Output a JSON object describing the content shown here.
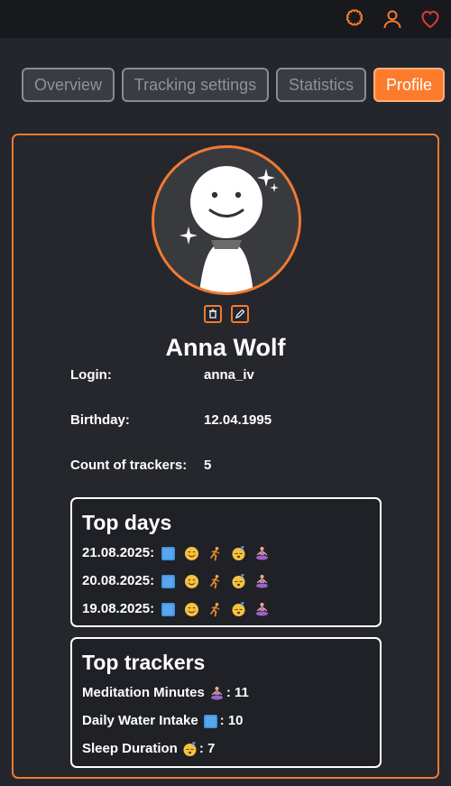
{
  "header": {
    "icons": [
      "settings-icon",
      "user-icon",
      "heart-icon"
    ]
  },
  "tabs": [
    {
      "label": "Overview",
      "active": false
    },
    {
      "label": "Tracking settings",
      "active": false
    },
    {
      "label": "Statistics",
      "active": false
    },
    {
      "label": "Profile",
      "active": true
    }
  ],
  "profile": {
    "name": "Anna Wolf",
    "actions": [
      "trash-icon",
      "pencil-icon"
    ],
    "fields": [
      {
        "label": "Login:",
        "value": "anna_iv"
      },
      {
        "label": "Birthday:",
        "value": "12.04.1995"
      },
      {
        "label": "Count of trackers:",
        "value": "5"
      }
    ]
  },
  "top_days": {
    "title": "Top days",
    "emojis": [
      "water-square-icon",
      "smile-icon",
      "runner-icon",
      "sleepy-icon",
      "meditation-icon"
    ],
    "days": [
      "21.08.2025:",
      "20.08.2025:",
      "19.08.2025:"
    ]
  },
  "top_trackers": {
    "title": "Top trackers",
    "items": [
      {
        "name": "Meditation Minutes",
        "icon": "meditation-icon",
        "value": ": 11"
      },
      {
        "name": "Daily Water Intake",
        "icon": "water-square-icon",
        "value": ": 10"
      },
      {
        "name": "Sleep Duration",
        "icon": "sleepy-icon",
        "value": ": 7"
      }
    ]
  },
  "colors": {
    "accent": "#f17a30",
    "active_tab": "#fd7b2c",
    "background": "#23262d",
    "topbar": "#17191d",
    "heart": "#e03a3a"
  }
}
